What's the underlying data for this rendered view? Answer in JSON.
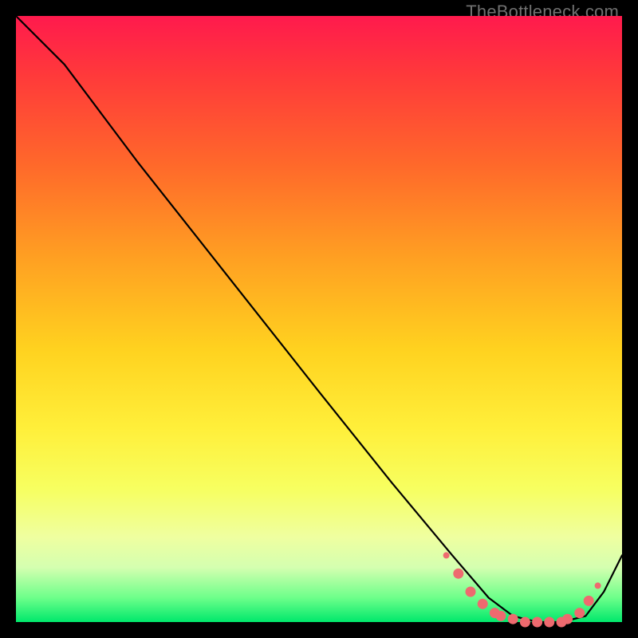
{
  "watermark": "TheBottleneck.com",
  "colors": {
    "background": "#000000",
    "line": "#000000",
    "dot": "#ee6a6f",
    "gradient_top": "#ff1a4d",
    "gradient_bottom": "#00e86c"
  },
  "chart_data": {
    "type": "line",
    "title": "",
    "xlabel": "",
    "ylabel": "",
    "xlim": [
      0,
      100
    ],
    "ylim": [
      0,
      100
    ],
    "x": [
      0,
      8,
      20,
      35,
      50,
      62,
      72,
      78,
      82,
      86,
      90,
      94,
      97,
      100
    ],
    "y": [
      100,
      92,
      76,
      57,
      38,
      23,
      11,
      4,
      1,
      0,
      0,
      1,
      5,
      11
    ],
    "dots_x": [
      71,
      73,
      75,
      77,
      79,
      80,
      82,
      84,
      86,
      88,
      90,
      91,
      93,
      94.5,
      96
    ],
    "dots_y": [
      11,
      8,
      5,
      3,
      1.5,
      1,
      0.5,
      0,
      0,
      0,
      0,
      0.5,
      1.5,
      3.5,
      6
    ],
    "annotations": []
  }
}
